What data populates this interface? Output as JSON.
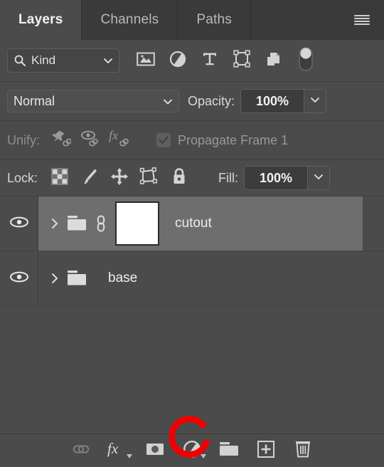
{
  "panel": {
    "title": "Layers",
    "background_color": "#4b4b4b",
    "annotation_color": "#f00000"
  },
  "tabs": [
    {
      "label": "Layers",
      "active": true
    },
    {
      "label": "Channels",
      "active": false
    },
    {
      "label": "Paths",
      "active": false
    }
  ],
  "menu": {
    "icon": "hamburger-menu-icon"
  },
  "filter_row": {
    "kind_label": "Kind",
    "search_icon": "search-icon",
    "chevron_icon": "chevron-down-icon",
    "type_filters": [
      {
        "name": "pixel-layer-filter",
        "icon": "image-icon"
      },
      {
        "name": "adjustment-layer-filter",
        "icon": "half-circle-icon"
      },
      {
        "name": "type-layer-filter",
        "icon": "text-t-icon"
      },
      {
        "name": "shape-layer-filter",
        "icon": "shape-bounds-icon"
      },
      {
        "name": "smart-object-filter",
        "icon": "smart-object-icon"
      }
    ],
    "toggle": {
      "name": "filter-enable-toggle",
      "state": "off"
    }
  },
  "blend_row": {
    "blend_mode": "Normal",
    "opacity_label": "Opacity:",
    "opacity_value": "100%"
  },
  "unify_row": {
    "unify_label": "Unify:",
    "buttons": [
      {
        "name": "unify-position-button",
        "icon": "pin-link-icon"
      },
      {
        "name": "unify-visibility-button",
        "icon": "eye-link-icon"
      },
      {
        "name": "unify-style-button",
        "icon": "fx-link-icon"
      }
    ],
    "propagate_label": "Propagate Frame 1",
    "propagate_checked": true
  },
  "lock_row": {
    "lock_label": "Lock:",
    "buttons": [
      {
        "name": "lock-transparent-pixels-button",
        "icon": "checkerboard-icon"
      },
      {
        "name": "lock-image-pixels-button",
        "icon": "brush-icon"
      },
      {
        "name": "lock-position-button",
        "icon": "move-arrows-icon"
      },
      {
        "name": "lock-artboard-nesting-button",
        "icon": "artboard-icon"
      },
      {
        "name": "lock-all-button",
        "icon": "lock-icon"
      }
    ],
    "fill_label": "Fill:",
    "fill_value": "100%"
  },
  "layers": [
    {
      "name": "cutout",
      "visible": true,
      "selected": true,
      "type": "group",
      "expanded": false,
      "has_link": true,
      "has_mask": true,
      "mask_color": "#ffffff"
    },
    {
      "name": "base",
      "visible": true,
      "selected": false,
      "type": "group",
      "expanded": false,
      "has_link": false,
      "has_mask": false
    }
  ],
  "bottom_toolbar": [
    {
      "name": "link-layers-button",
      "icon": "link-icon",
      "dimmed": true,
      "highlighted": false
    },
    {
      "name": "layer-style-button",
      "icon": "fx-icon",
      "dimmed": false,
      "highlighted": false
    },
    {
      "name": "add-layer-mask-button",
      "icon": "add-mask-icon",
      "dimmed": false,
      "highlighted": true
    },
    {
      "name": "new-adjustment-layer-button",
      "icon": "half-circle-icon",
      "dimmed": false,
      "highlighted": false
    },
    {
      "name": "new-group-button",
      "icon": "folder-icon",
      "dimmed": false,
      "highlighted": false
    },
    {
      "name": "new-layer-button",
      "icon": "plus-square-icon",
      "dimmed": false,
      "highlighted": false
    },
    {
      "name": "delete-layer-button",
      "icon": "trash-icon",
      "dimmed": false,
      "highlighted": false
    }
  ]
}
